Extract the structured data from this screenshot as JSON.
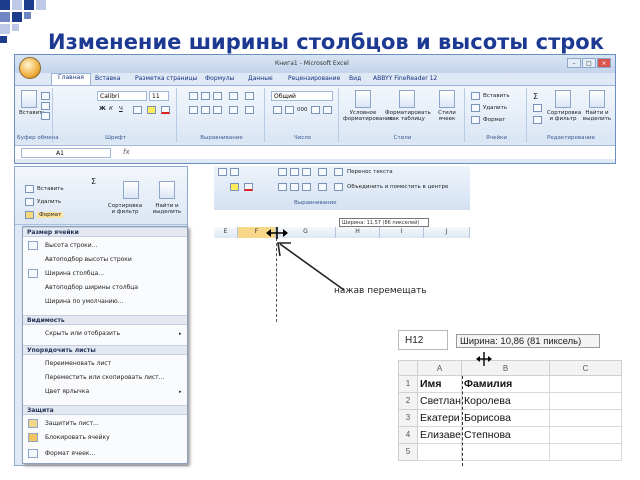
{
  "slide": {
    "title": "Изменение ширины столбцов и высоты строк"
  },
  "excel": {
    "window_title": "Книга1 - Microsoft Excel",
    "tabs": [
      "Главная",
      "Вставка",
      "Разметка страницы",
      "Формулы",
      "Данные",
      "Рецензирование",
      "Вид",
      "ABBYY FineReader 12"
    ],
    "active_tab": "Главная",
    "groups": [
      "Буфер обмена",
      "Шрифт",
      "Выравнивание",
      "Число",
      "Стили",
      "Ячейки",
      "Редактирование"
    ],
    "paste_label": "Вставить",
    "font_name": "Calibri",
    "font_size": "11",
    "number_format": "Общий",
    "cond_format_label": "Условное форматирование",
    "format_table_label": "Форматировать как таблицу",
    "cell_styles_label": "Стили ячеек",
    "insert_label": "Вставить",
    "delete_label": "Удалить",
    "format_label": "Формат",
    "sort_label": "Сортировка и фильтр",
    "find_label": "Найти и выделить",
    "name_box": "A1",
    "fx": "fx"
  },
  "format_menu": {
    "ribbon_insert": "Вставить",
    "ribbon_delete": "Удалить",
    "ribbon_format": "Формат",
    "ribbon_sort": "Сортировка и фильтр",
    "ribbon_find": "Найти и выделить",
    "sections": [
      {
        "header": "Размер ячейки",
        "items": [
          "Высота строки...",
          "Автоподбор высоты строки",
          "Ширина столбца...",
          "Автоподбор ширины столбца",
          "Ширина по умолчанию..."
        ]
      },
      {
        "header": "Видимость",
        "items": [
          "Скрыть или отобразить"
        ]
      },
      {
        "header": "Упорядочить листы",
        "items": [
          "Переименовать лист",
          "Переместить или скопировать лист...",
          "Цвет ярлычка"
        ]
      },
      {
        "header": "Защита",
        "items": [
          "Защитить лист...",
          "Блокировать ячейку",
          "Формат ячеек..."
        ]
      }
    ]
  },
  "middle_shot": {
    "wrap_text": "Перенос текста",
    "merge_center": "Объединить и поместить в центре",
    "align_group": "Выравнивание",
    "tooltip": "Ширина: 11,57 (86 пикселей)",
    "columns": [
      "E",
      "F",
      "G",
      "H",
      "I",
      "J"
    ]
  },
  "callout": "нажав перемещать",
  "sheet": {
    "name_box": "H12",
    "tooltip": "Ширина: 10,86 (81 пиксель)",
    "columns": [
      "A",
      "B",
      "C"
    ],
    "rows": [
      "1",
      "2",
      "3",
      "4",
      "5"
    ],
    "data": [
      [
        "Имя",
        "Фамилия"
      ],
      [
        "Светлан",
        "Королева"
      ],
      [
        "Екатери",
        "Борисова"
      ],
      [
        "Елизаве",
        "Степнова"
      ],
      [
        "",
        ""
      ]
    ]
  },
  "colors": {
    "title": "#1d3a93",
    "squares_dark": "#1e3c8c",
    "squares_light": "#bdc9e6",
    "ribbon": "#dfe9f6"
  }
}
